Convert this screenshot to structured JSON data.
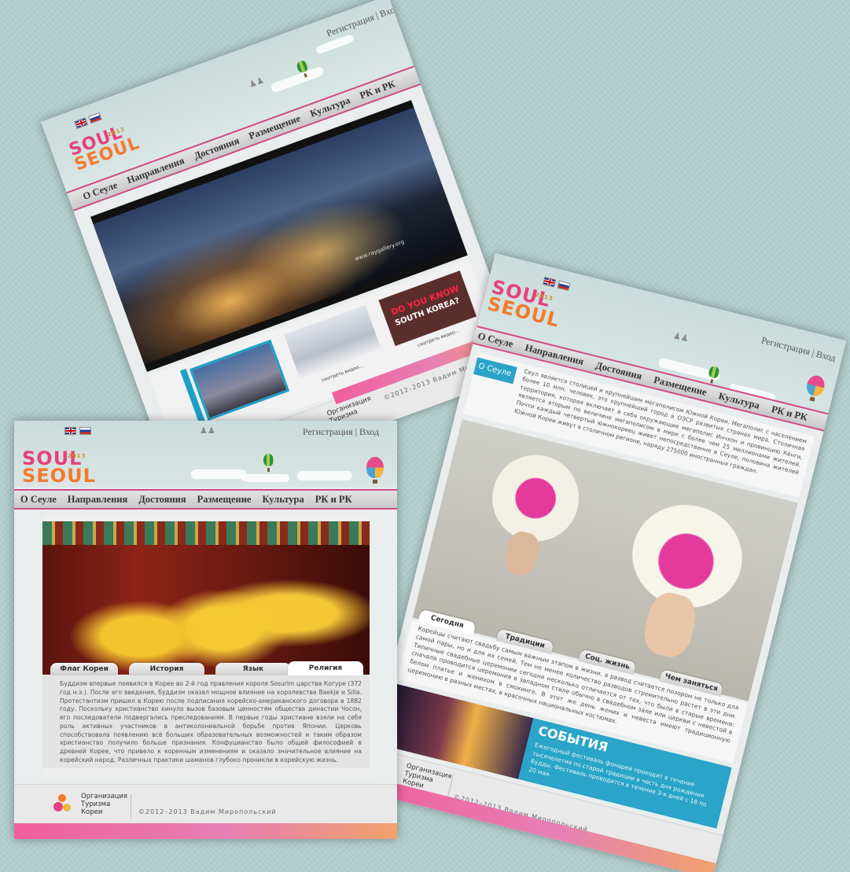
{
  "flags": {
    "uk": "gb-flag-icon",
    "ru": "ru-flag-icon"
  },
  "auth": {
    "register": "Регистрация",
    "separator": "|",
    "login": "Вход"
  },
  "logo": {
    "line1": "SOUL",
    "line2": "SEOUL",
    "year": "2013"
  },
  "nav": [
    "О Сеуле",
    "Направления",
    "Достояния",
    "Размещение",
    "Культура",
    "РК и РК"
  ],
  "footer": {
    "org_line1": "Организация",
    "org_line2": "Туризма",
    "org_line3": "Кореи",
    "copyright": "©2012–2013 Вадим Миропольский"
  },
  "page1": {
    "watermark": "www.raygallery.org",
    "video_label": "смотреть видео...",
    "thumb3_line1": "DO YOU KNOW",
    "thumb3_line2": "SOUTH KOREA?"
  },
  "page2": {
    "tabs": [
      "Флаг Кореи",
      "История",
      "Язык",
      "Религия"
    ],
    "text": "Буддизм впервые появился в Корее во 2-й год правления короля Sosurim царства Когуре (372 год н.э.). После его введения, буддизм оказал мощное влияние на королевства Baekje и Silla. Протестантизм пришел в Корею после подписания корейско-американского договора в 1882 году. Поскольку христианство кинуло вызов базовым ценностям общества династии Чосон, его последователи подвергались преследованиям. В первые годы христиане взяли на себя роль активных участников в антиколониальной борьбе против Японии. Церковь способствовала появлению всё больших образовательных возможностей и таким образом христианство получило больше признания. Конфуцианство было общей философией в древней Корее, что привело к коренным изменениям и оказало значительное влияние на корейский народ. Различных практики шаманов глубоко проникли в корейскую жизнь."
  },
  "page3": {
    "badge": "О Сеуле",
    "intro": "Сеул является столицей и крупнейшим мегаполисом Южной Кореи. Мегаполис с населением более 10 млн. человек, это крупнейший город в ОЭСР развитых странах мира. Столичная территория, которая включает в себя окружающие мегаполис Инчхон и провинцию Кёнги, является вторым по величине мегаполисом в мире с более чем 25 миллионами жителей. Почти каждый четвертый южнокореец живет непосредственно в Сеуле, половина жителей Южной Кореи живут в столичном регионе, наряду 275000 иностранных граждан.",
    "tabs": [
      "Сегодня",
      "Традиции",
      "Соц. жизнь",
      "Чем заняться"
    ],
    "text": "Корейцы считают свадьбу самым важным этапом в жизни, а развод считается позором не только для самой пары, но и для их семей. Тем не менее количество разводов стремительно растет в эти дни. Типичные свадебные церемонии сегодня несколько отличается от тех, что были в старые времена: сначала проводится церемония в западном стиле обычно в свадебном зале или церкви с невестой в белом платье и женихом в смокинге. В этот же день жених и невеста имеют традиционную церемонию в разных местах, в красочных национальных костюмах.",
    "events_title": "СОБЫТИЯ",
    "events_text": "Ежегодный фестиваль фонарей проходит в течение тысячелетия по старой традиции в честь дня рождения Будды. Фестиваль проводится в течение 3-х дней с 18 по 20 мая."
  },
  "colors": {
    "pink": "#e8407e",
    "orange": "#f47a2e",
    "events_blue": "#2aa4c8",
    "nav_border": "#d04a86"
  }
}
